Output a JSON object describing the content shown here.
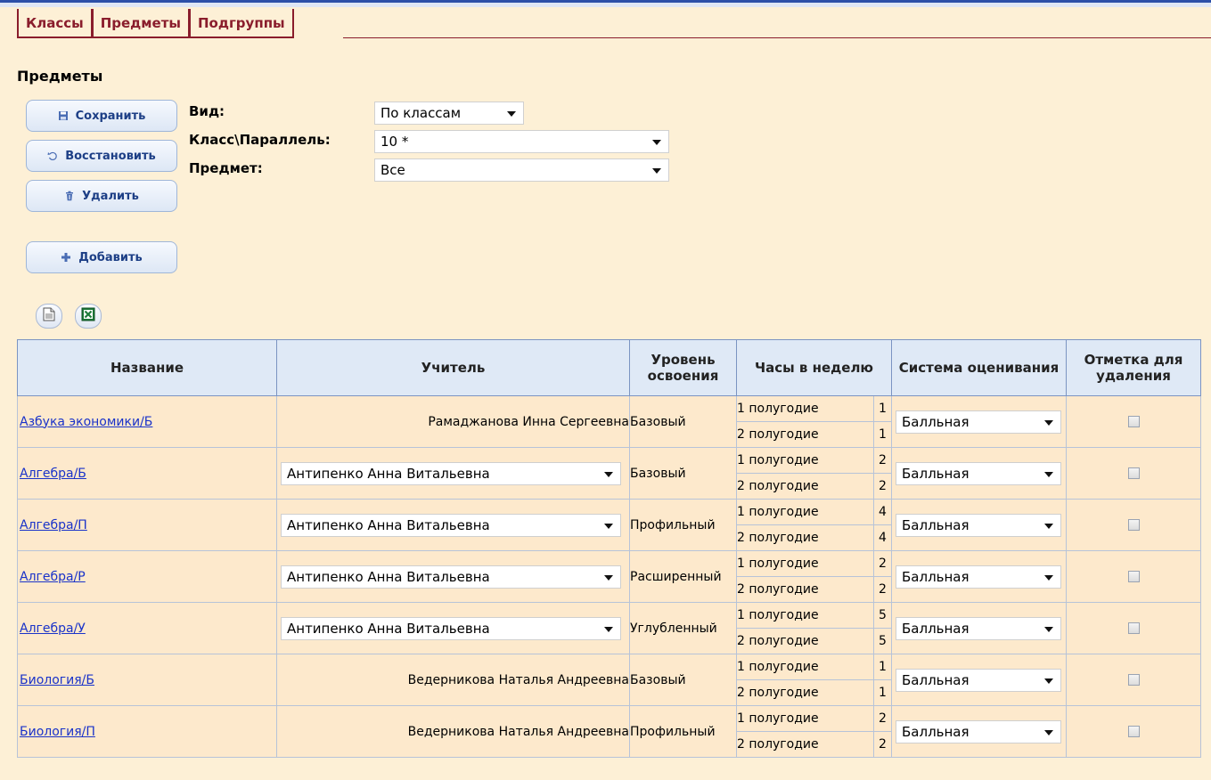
{
  "tabs": [
    {
      "label": "Классы"
    },
    {
      "label": "Предметы"
    },
    {
      "label": "Подгруппы"
    }
  ],
  "page_title": "Предметы",
  "buttons": {
    "save": "Сохранить",
    "restore": "Восстановить",
    "delete": "Удалить",
    "add": "Добавить"
  },
  "filters": {
    "view_label": "Вид:",
    "view_value": "По классам",
    "class_label": "Класс\\Параллель:",
    "class_value": "10 *",
    "subject_label": "Предмет:",
    "subject_value": "Все"
  },
  "icons": {
    "report": "document-icon",
    "excel": "excel-icon"
  },
  "table": {
    "headers": {
      "name": "Название",
      "teacher": "Учитель",
      "level": "Уровень освоения",
      "hours": "Часы в неделю",
      "grading": "Система оценивания",
      "mark": "Отметка для удаления"
    },
    "rows": [
      {
        "name": "Азбука экономики/Б",
        "teacher": "Рамаджанова Инна Сергеевна",
        "teacher_select": false,
        "level": "Базовый",
        "h1_label": "1 полугодие",
        "h1": "1",
        "h2_label": "2 полугодие",
        "h2": "1",
        "grading": "Балльная"
      },
      {
        "name": "Алгебра/Б",
        "teacher": "Антипенко Анна Витальевна",
        "teacher_select": true,
        "level": "Базовый",
        "h1_label": "1 полугодие",
        "h1": "2",
        "h2_label": "2 полугодие",
        "h2": "2",
        "grading": "Балльная"
      },
      {
        "name": "Алгебра/П",
        "teacher": "Антипенко Анна Витальевна",
        "teacher_select": true,
        "level": "Профильный",
        "h1_label": "1 полугодие",
        "h1": "4",
        "h2_label": "2 полугодие",
        "h2": "4",
        "grading": "Балльная"
      },
      {
        "name": "Алгебра/Р",
        "teacher": "Антипенко Анна Витальевна",
        "teacher_select": true,
        "level": "Расширенный",
        "h1_label": "1 полугодие",
        "h1": "2",
        "h2_label": "2 полугодие",
        "h2": "2",
        "grading": "Балльная"
      },
      {
        "name": "Алгебра/У",
        "teacher": "Антипенко Анна Витальевна",
        "teacher_select": true,
        "level": "Углубленный",
        "h1_label": "1 полугодие",
        "h1": "5",
        "h2_label": "2 полугодие",
        "h2": "5",
        "grading": "Балльная"
      },
      {
        "name": "Биология/Б",
        "teacher": "Ведерникова Наталья Андреевна",
        "teacher_select": false,
        "level": "Базовый",
        "h1_label": "1 полугодие",
        "h1": "1",
        "h2_label": "2 полугодие",
        "h2": "1",
        "grading": "Балльная"
      },
      {
        "name": "Биология/П",
        "teacher": "Ведерникова Наталья Андреевна",
        "teacher_select": false,
        "level": "Профильный",
        "h1_label": "1 полугодие",
        "h1": "2",
        "h2_label": "2 полугодие",
        "h2": "2",
        "grading": "Балльная"
      }
    ]
  }
}
